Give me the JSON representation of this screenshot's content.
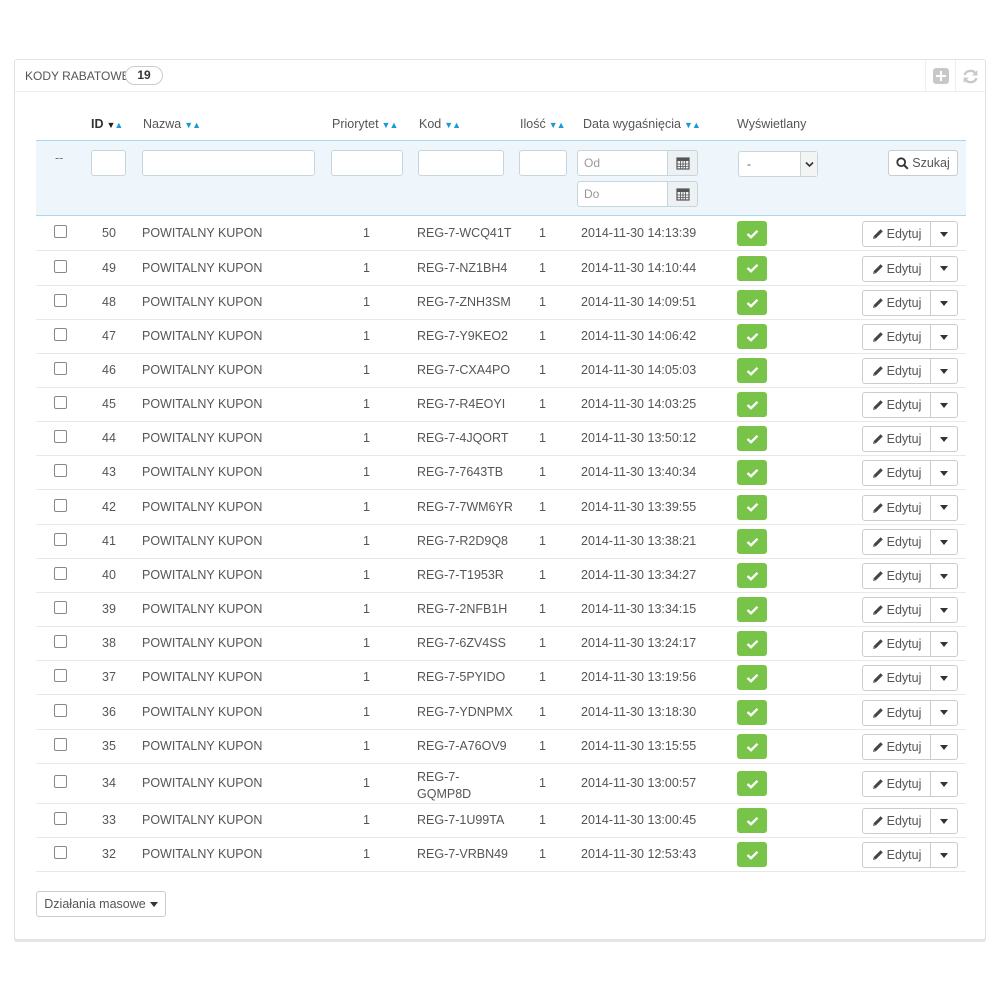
{
  "panel": {
    "title": "KODY RABATOWE",
    "count": "19",
    "icons": [
      "add-icon",
      "refresh-icon"
    ]
  },
  "columns": {
    "id": "ID",
    "name": "Nazwa",
    "priority": "Priorytet",
    "code": "Kod",
    "quantity": "Ilość",
    "expiry": "Data wygaśnięcia",
    "displayed": "Wyświetlany"
  },
  "filters": {
    "dash": "--",
    "date_from_placeholder": "Od",
    "date_to_placeholder": "Do",
    "displayed_selected": "-",
    "search_label": "Szukaj"
  },
  "rows": [
    {
      "id": "50",
      "name": "POWITALNY KUPON",
      "priority": "1",
      "code": "REG-7-WCQ41T",
      "qty": "1",
      "date": "2014-11-30 14:13:39"
    },
    {
      "id": "49",
      "name": "POWITALNY KUPON",
      "priority": "1",
      "code": "REG-7-NZ1BH4",
      "qty": "1",
      "date": "2014-11-30 14:10:44"
    },
    {
      "id": "48",
      "name": "POWITALNY KUPON",
      "priority": "1",
      "code": "REG-7-ZNH3SM",
      "qty": "1",
      "date": "2014-11-30 14:09:51"
    },
    {
      "id": "47",
      "name": "POWITALNY KUPON",
      "priority": "1",
      "code": "REG-7-Y9KEO2",
      "qty": "1",
      "date": "2014-11-30 14:06:42"
    },
    {
      "id": "46",
      "name": "POWITALNY KUPON",
      "priority": "1",
      "code": "REG-7-CXA4PO",
      "qty": "1",
      "date": "2014-11-30 14:05:03"
    },
    {
      "id": "45",
      "name": "POWITALNY KUPON",
      "priority": "1",
      "code": "REG-7-R4EOYI",
      "qty": "1",
      "date": "2014-11-30 14:03:25"
    },
    {
      "id": "44",
      "name": "POWITALNY KUPON",
      "priority": "1",
      "code": "REG-7-4JQORT",
      "qty": "1",
      "date": "2014-11-30 13:50:12"
    },
    {
      "id": "43",
      "name": "POWITALNY KUPON",
      "priority": "1",
      "code": "REG-7-7643TB",
      "qty": "1",
      "date": "2014-11-30 13:40:34"
    },
    {
      "id": "42",
      "name": "POWITALNY KUPON",
      "priority": "1",
      "code": "REG-7-7WM6YR",
      "qty": "1",
      "date": "2014-11-30 13:39:55"
    },
    {
      "id": "41",
      "name": "POWITALNY KUPON",
      "priority": "1",
      "code": "REG-7-R2D9Q8",
      "qty": "1",
      "date": "2014-11-30 13:38:21"
    },
    {
      "id": "40",
      "name": "POWITALNY KUPON",
      "priority": "1",
      "code": "REG-7-T1953R",
      "qty": "1",
      "date": "2014-11-30 13:34:27"
    },
    {
      "id": "39",
      "name": "POWITALNY KUPON",
      "priority": "1",
      "code": "REG-7-2NFB1H",
      "qty": "1",
      "date": "2014-11-30 13:34:15"
    },
    {
      "id": "38",
      "name": "POWITALNY KUPON",
      "priority": "1",
      "code": "REG-7-6ZV4SS",
      "qty": "1",
      "date": "2014-11-30 13:24:17"
    },
    {
      "id": "37",
      "name": "POWITALNY KUPON",
      "priority": "1",
      "code": "REG-7-5PYIDO",
      "qty": "1",
      "date": "2014-11-30 13:19:56"
    },
    {
      "id": "36",
      "name": "POWITALNY KUPON",
      "priority": "1",
      "code": "REG-7-YDNPMX",
      "qty": "1",
      "date": "2014-11-30 13:18:30"
    },
    {
      "id": "35",
      "name": "POWITALNY KUPON",
      "priority": "1",
      "code": "REG-7-A76OV9",
      "qty": "1",
      "date": "2014-11-30 13:15:55"
    },
    {
      "id": "34",
      "name": "POWITALNY KUPON",
      "priority": "1",
      "code": "REG-7-",
      "code2": "GQMP8D",
      "qty": "1",
      "date": "2014-11-30 13:00:57"
    },
    {
      "id": "33",
      "name": "POWITALNY KUPON",
      "priority": "1",
      "code": "REG-7-1U99TA",
      "qty": "1",
      "date": "2014-11-30 13:00:45"
    },
    {
      "id": "32",
      "name": "POWITALNY KUPON",
      "priority": "1",
      "code": "REG-7-VRBN49",
      "qty": "1",
      "date": "2014-11-30 12:53:43"
    }
  ],
  "row_actions": {
    "edit_label": "Edytuj"
  },
  "bulk": {
    "label": "Działania masowe"
  },
  "colors": {
    "accent": "#1a9ad6",
    "success": "#78c448",
    "filter_bg": "#eef6fc"
  }
}
